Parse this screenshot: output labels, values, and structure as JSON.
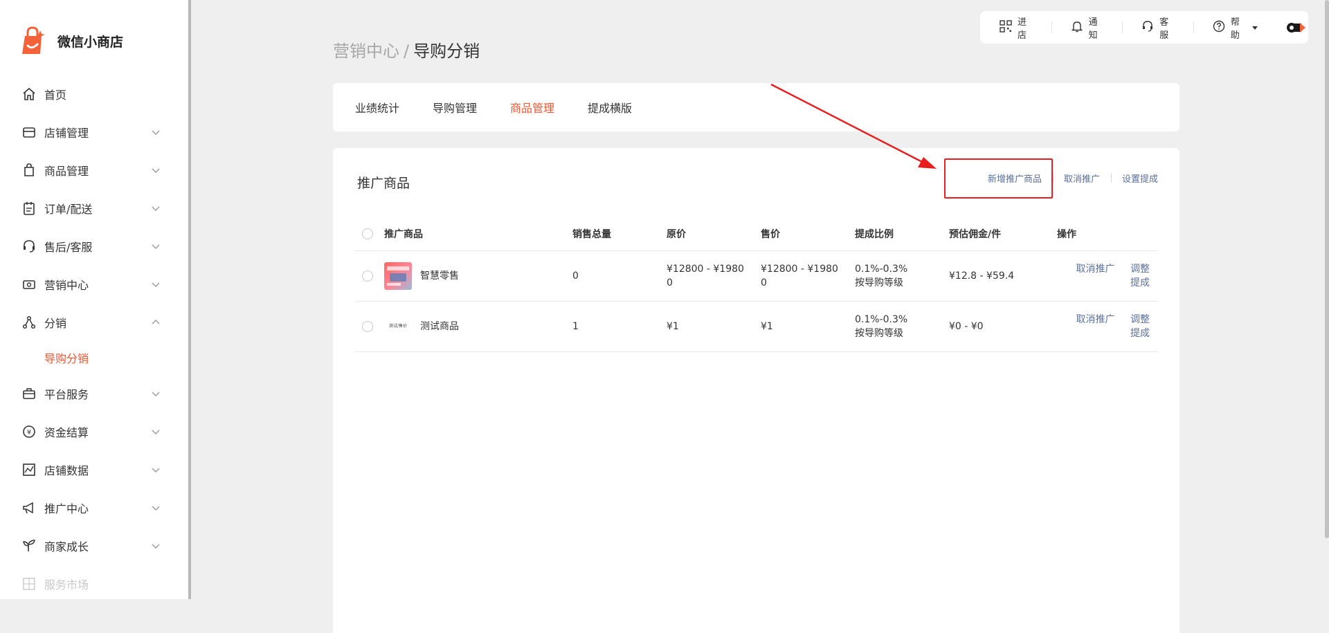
{
  "brand": {
    "name": "微信小商店"
  },
  "sidebar": {
    "items": [
      {
        "label": "首页",
        "icon": "home-icon",
        "expandable": false
      },
      {
        "label": "店铺管理",
        "icon": "store-icon",
        "expandable": true
      },
      {
        "label": "商品管理",
        "icon": "shopping-bag-icon",
        "expandable": true
      },
      {
        "label": "订单/配送",
        "icon": "clipboard-icon",
        "expandable": true
      },
      {
        "label": "售后/客服",
        "icon": "headset-icon",
        "expandable": true
      },
      {
        "label": "营销中心",
        "icon": "ticket-icon",
        "expandable": true
      },
      {
        "label": "分销",
        "icon": "share-nodes-icon",
        "expandable": true,
        "expanded": true,
        "children": [
          "导购分销"
        ]
      },
      {
        "label": "平台服务",
        "icon": "briefcase-icon",
        "expandable": true
      },
      {
        "label": "资金结算",
        "icon": "yen-coin-icon",
        "expandable": true
      },
      {
        "label": "店铺数据",
        "icon": "chart-icon",
        "expandable": true
      },
      {
        "label": "推广中心",
        "icon": "megaphone-icon",
        "expandable": true
      },
      {
        "label": "商家成长",
        "icon": "sprout-icon",
        "expandable": true
      },
      {
        "label": "服务市场",
        "icon": "puzzle-icon",
        "expandable": false,
        "disabled": true
      }
    ]
  },
  "topbar": {
    "enter_store": "进店",
    "notify": "通知",
    "service": "客服",
    "help": "帮助"
  },
  "breadcrumb": {
    "parent": "营销中心",
    "separator": "/",
    "current": "导购分销"
  },
  "tabs": [
    "业绩统计",
    "导购管理",
    "商品管理",
    "提成横版"
  ],
  "active_tab": 2,
  "section": {
    "title": "推广商品",
    "actions": [
      "新增推广商品",
      "取消推广",
      "设置提成"
    ]
  },
  "table": {
    "headers": [
      "推广商品",
      "销售总量",
      "原价",
      "售价",
      "提成比例",
      "预估佣金/件",
      "操作"
    ],
    "rows": [
      {
        "name": "智慧零售",
        "sales": "0",
        "orig_price": "¥12800 - ¥1980\n0",
        "sale_price": "¥12800 - ¥1980\n0",
        "ratio_line1": "0.1%-0.3%",
        "ratio_line2": "按导购等级",
        "commission": "¥12.8 - ¥59.4",
        "op1": "取消推广",
        "op2": "调整提成"
      },
      {
        "name": "测试商品",
        "thumb_text": "测试/售价",
        "sales": "1",
        "orig_price": "¥1",
        "sale_price": "¥1",
        "ratio_line1": "0.1%-0.3%",
        "ratio_line2": "按导购等级",
        "commission": "¥0 - ¥0",
        "op1": "取消推广",
        "op2": "调整提成"
      }
    ]
  },
  "colors": {
    "accent": "#f2522e",
    "link": "#5a6f9e",
    "annotation": "#e81e1e"
  }
}
